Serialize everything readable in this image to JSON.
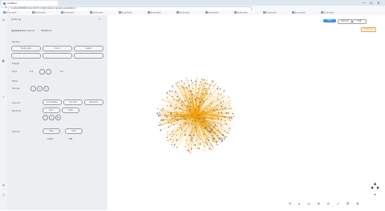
{
  "browser": {
    "tab_title": "Untitled",
    "url": "localhost:8080/index.html?config=network-graph-visualization",
    "window_controls": [
      "—",
      "☐",
      "✕"
    ],
    "bookmarks": [
      "Bookmark",
      "Bookmark",
      "Bookmark",
      "Bookmark",
      "Bookmark",
      "Bookmark",
      "Bookmark",
      "Bookmark",
      "Bookmark",
      "Bookmark",
      "Bookmark",
      "Bookmark"
    ]
  },
  "sidebar_icons": [
    "menu-icon",
    "layers-icon",
    "filter-icon",
    "settings-icon",
    "info-icon"
  ],
  "panel": {
    "title": "Settings",
    "tabs": [
      "Appearance",
      "Layout",
      "Statistics"
    ],
    "section_nodes": "Nodes",
    "node_buttons": [
      "Node size",
      "Color",
      "Label"
    ],
    "section_edges": "Edges",
    "edge_label": "Size",
    "edge_values": [
      "0.1",
      "10"
    ],
    "section_filter": "Filter",
    "filter_label": "Range",
    "circle_buttons": [
      "-",
      "+",
      "×"
    ],
    "section_layout": "Layout",
    "layout_buttons": [
      "ForceAtlas",
      "Circular",
      "Random"
    ],
    "section_params": "Params",
    "param_buttons": [
      "Run",
      "Stop"
    ],
    "param_circles": [
      "↺",
      "⏸",
      "▶"
    ],
    "section_export": "Export",
    "export_buttons": [
      "PNG",
      "SVG"
    ],
    "export_values": [
      "1024",
      "768"
    ]
  },
  "toolbar": {
    "view_button": "View",
    "options_button": "Options",
    "extra_button": "Edit",
    "highlight_button": "Fullscreen"
  },
  "bottom_toolbar": [
    "⟲",
    "⌂",
    "▭",
    "⊕",
    "⊖",
    "⤢",
    "☰",
    "⚙"
  ],
  "colors": {
    "accent": "#3a8ee6",
    "edge": "#f2a20a",
    "node": "#7a7a7a",
    "highlight": "#f0a030"
  }
}
